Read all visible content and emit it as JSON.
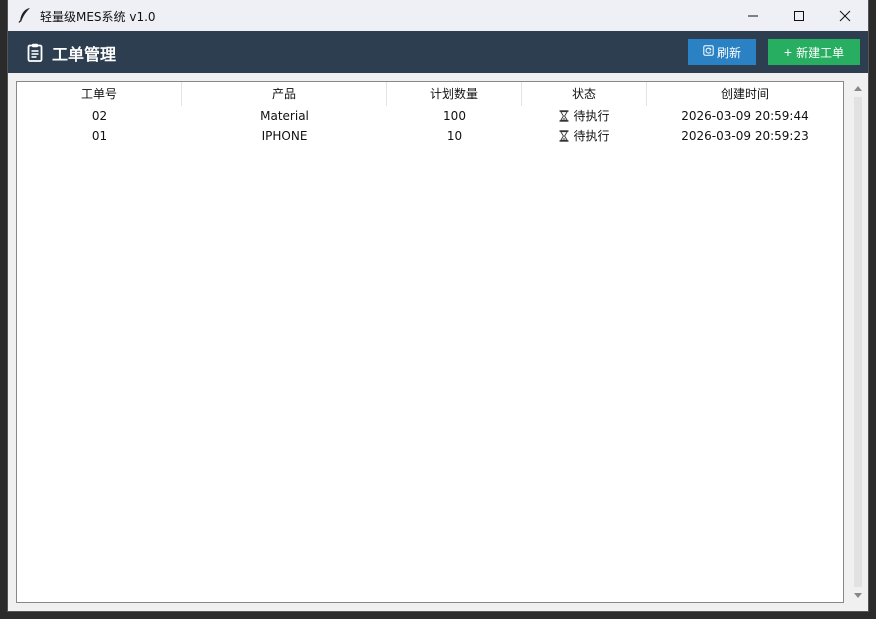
{
  "window": {
    "title": "轻量级MES系统 v1.0"
  },
  "header": {
    "title": "工单管理",
    "refresh_label": "刷新",
    "new_label": "新建工单",
    "new_prefix": "+"
  },
  "table": {
    "columns": [
      "工单号",
      "产品",
      "计划数量",
      "状态",
      "创建时间"
    ],
    "rows": [
      {
        "id": "02",
        "product": "Material",
        "qty": "100",
        "status": "待执行",
        "created": "2026-03-09 20:59:44"
      },
      {
        "id": "01",
        "product": "IPHONE",
        "qty": "10",
        "status": "待执行",
        "created": "2026-03-09 20:59:23"
      }
    ]
  },
  "colors": {
    "header_bg": "#2c3e50",
    "refresh_bg": "#2a82c4",
    "new_bg": "#27ae60"
  }
}
